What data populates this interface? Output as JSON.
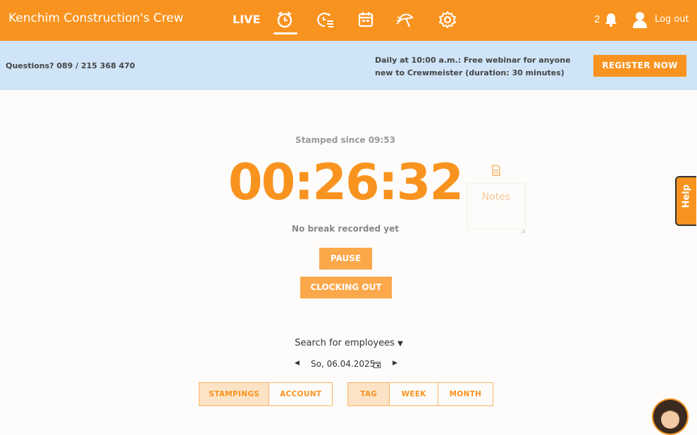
{
  "header": {
    "brand": "Kenchim Construction's Crew",
    "live_label": "LIVE",
    "notification_count": "2",
    "logout_label": "Log out",
    "accent_color": "#f9931f"
  },
  "nav_icons": [
    "stopwatch-icon",
    "time-list-icon",
    "calendar-icon",
    "vacation-icon",
    "settings-icon"
  ],
  "infobar": {
    "questions": "Questions? 089 / 215 368 470",
    "webinar": "Daily at 10:00 a.m.: Free webinar for anyone new to Crewmeister (duration: 30 minutes)",
    "register_label": "REGISTER NOW"
  },
  "timer": {
    "stamped_since": "Stamped since 09:53",
    "elapsed": "00:26:32",
    "break_status": "No break recorded yet",
    "notes_placeholder": "Notes",
    "pause_label": "PAUSE",
    "clockout_label": "CLOCKING OUT"
  },
  "help_label": "Help",
  "search_employees": "Search for employees",
  "date": {
    "value": "So, 06.04.2025"
  },
  "view_toggle": {
    "stampings": "STAMPINGS",
    "account": "ACCOUNT"
  },
  "period_toggle": {
    "tag": "TAG",
    "week": "WEEK",
    "month": "MONTH"
  }
}
